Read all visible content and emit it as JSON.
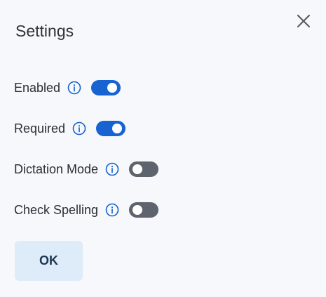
{
  "dialog": {
    "title": "Settings",
    "close_icon": "close-icon",
    "ok_label": "OK"
  },
  "settings": [
    {
      "label": "Enabled",
      "enabled": true,
      "info_icon": "info-icon"
    },
    {
      "label": "Required",
      "enabled": true,
      "info_icon": "info-icon"
    },
    {
      "label": "Dictation Mode",
      "enabled": false,
      "info_icon": "info-icon"
    },
    {
      "label": "Check Spelling",
      "enabled": false,
      "info_icon": "info-icon"
    }
  ],
  "colors": {
    "toggle_on": "#1763d1",
    "toggle_off": "#5d646d",
    "info_icon": "#1763d1",
    "ok_button_bg": "#deebf9"
  }
}
